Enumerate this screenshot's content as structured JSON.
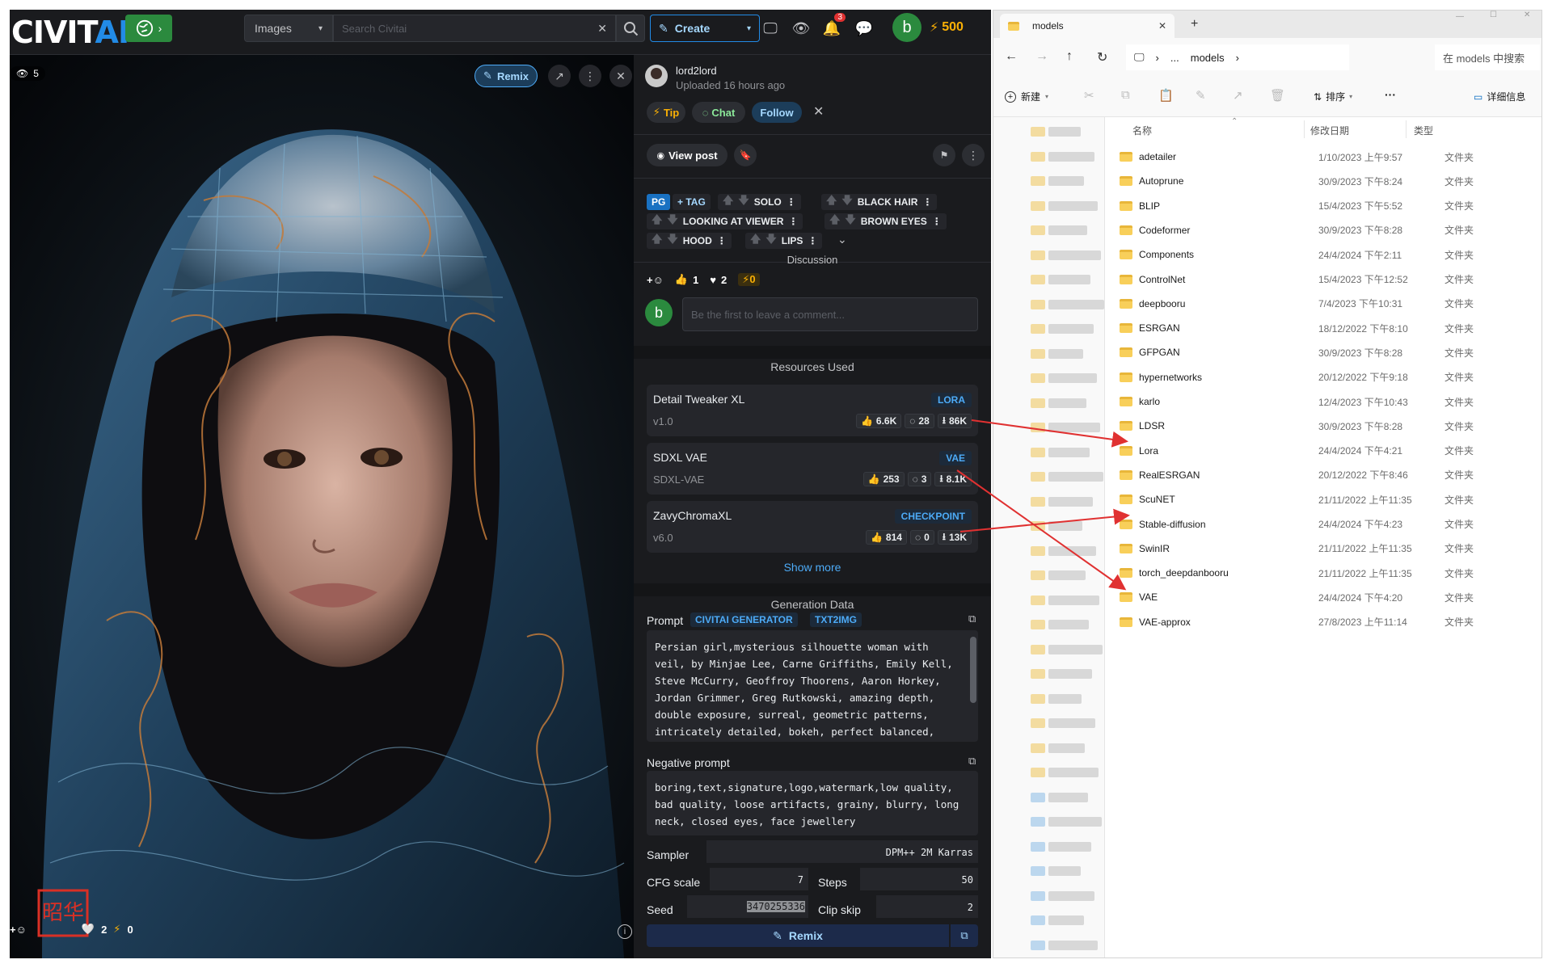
{
  "civitai": {
    "logo": {
      "text_civit": "CIVIT",
      "text_ai": "AI"
    },
    "search": {
      "category": "Images",
      "placeholder": "Search Civitai"
    },
    "create_label": "Create",
    "notification_count": "3",
    "user_initial": "b",
    "buzz": "500",
    "view_count": "5",
    "remix_label": "Remix",
    "bottom_counts": {
      "likes": "2",
      "buzz": "0"
    },
    "author": {
      "name": "lord2lord",
      "uploaded": "Uploaded 16 hours ago"
    },
    "actions": {
      "tip": "Tip",
      "chat": "Chat",
      "follow": "Follow"
    },
    "view_post": "View post",
    "rating": "PG",
    "add_tag": "+ TAG",
    "tags": [
      "SOLO",
      "BLACK HAIR",
      "LOOKING AT VIEWER",
      "BROWN EYES",
      "HOOD",
      "LIPS"
    ],
    "discussion": {
      "heading": "Discussion",
      "reactions": {
        "thumbs": "1",
        "hearts": "2",
        "buzz": "0"
      },
      "comment_placeholder": "Be the first to leave a comment..."
    },
    "resources": {
      "heading": "Resources Used",
      "items": [
        {
          "name": "Detail Tweaker XL",
          "type": "LORA",
          "version": "v1.0",
          "likes": "6.6K",
          "comments": "28",
          "downloads": "86K"
        },
        {
          "name": "SDXL VAE",
          "type": "VAE",
          "version": "SDXL-VAE",
          "likes": "253",
          "comments": "3",
          "downloads": "8.1K"
        },
        {
          "name": "ZavyChromaXL",
          "type": "CHECKPOINT",
          "version": "v6.0",
          "likes": "814",
          "comments": "0",
          "downloads": "13K"
        }
      ],
      "show_more": "Show more"
    },
    "generation": {
      "heading": "Generation Data",
      "prompt_label": "Prompt",
      "badges": [
        "CIVITAI GENERATOR",
        "TXT2IMG"
      ],
      "prompt": "Persian girl,mysterious silhouette woman with veil, by Minjae Lee, Carne Griffiths, Emily Kell, Steve McCurry, Geoffroy Thoorens, Aaron Horkey, Jordan Grimmer, Greg Rutkowski, amazing depth, double exposure, surreal, geometric patterns, intricately detailed, bokeh, perfect balanced, deep fine borders, artistic",
      "negative_label": "Negative prompt",
      "negative": "boring,text,signature,logo,watermark,low quality, bad quality, loose artifacts, grainy, blurry, long neck, closed eyes, face jewellery",
      "sampler_label": "Sampler",
      "sampler": "DPM++ 2M Karras",
      "cfg_label": "CFG scale",
      "cfg": "7",
      "steps_label": "Steps",
      "steps": "50",
      "seed_label": "Seed",
      "seed": "3470255336",
      "clip_label": "Clip skip",
      "clip": "2",
      "remix_label": "Remix"
    },
    "stamp_text": "昭华"
  },
  "explorer": {
    "tab_title": "models",
    "breadcrumb": [
      "...",
      "models"
    ],
    "search_placeholder": "在 models 中搜索",
    "toolbar": {
      "new": "新建",
      "sort": "排序",
      "more": "···",
      "details": "详细信息"
    },
    "columns": {
      "name": "名称",
      "date": "修改日期",
      "type": "类型"
    },
    "rows": [
      {
        "name": "adetailer",
        "date": "1/10/2023 上午9:57",
        "type": "文件夹"
      },
      {
        "name": "Autoprune",
        "date": "30/9/2023 下午8:24",
        "type": "文件夹"
      },
      {
        "name": "BLIP",
        "date": "15/4/2023 下午5:52",
        "type": "文件夹"
      },
      {
        "name": "Codeformer",
        "date": "30/9/2023 下午8:28",
        "type": "文件夹"
      },
      {
        "name": "Components",
        "date": "24/4/2024 下午2:11",
        "type": "文件夹"
      },
      {
        "name": "ControlNet",
        "date": "15/4/2023 下午12:52",
        "type": "文件夹"
      },
      {
        "name": "deepbooru",
        "date": "7/4/2023 下午10:31",
        "type": "文件夹"
      },
      {
        "name": "ESRGAN",
        "date": "18/12/2022 下午8:10",
        "type": "文件夹"
      },
      {
        "name": "GFPGAN",
        "date": "30/9/2023 下午8:28",
        "type": "文件夹"
      },
      {
        "name": "hypernetworks",
        "date": "20/12/2022 下午9:18",
        "type": "文件夹"
      },
      {
        "name": "karlo",
        "date": "12/4/2023 下午10:43",
        "type": "文件夹"
      },
      {
        "name": "LDSR",
        "date": "30/9/2023 下午8:28",
        "type": "文件夹"
      },
      {
        "name": "Lora",
        "date": "24/4/2024 下午4:21",
        "type": "文件夹"
      },
      {
        "name": "RealESRGAN",
        "date": "20/12/2022 下午8:46",
        "type": "文件夹"
      },
      {
        "name": "ScuNET",
        "date": "21/11/2022 上午11:35",
        "type": "文件夹"
      },
      {
        "name": "Stable-diffusion",
        "date": "24/4/2024 下午4:23",
        "type": "文件夹"
      },
      {
        "name": "SwinIR",
        "date": "21/11/2022 上午11:35",
        "type": "文件夹"
      },
      {
        "name": "torch_deepdanbooru",
        "date": "21/11/2022 上午11:35",
        "type": "文件夹"
      },
      {
        "name": "VAE",
        "date": "24/4/2024 下午4:20",
        "type": "文件夹"
      },
      {
        "name": "VAE-approx",
        "date": "27/8/2023 上午11:14",
        "type": "文件夹"
      }
    ]
  },
  "colors": {
    "accent": "#228be6",
    "buzz": "#fab005",
    "annotation": "#e03131",
    "folder": "#f8cf5a"
  }
}
